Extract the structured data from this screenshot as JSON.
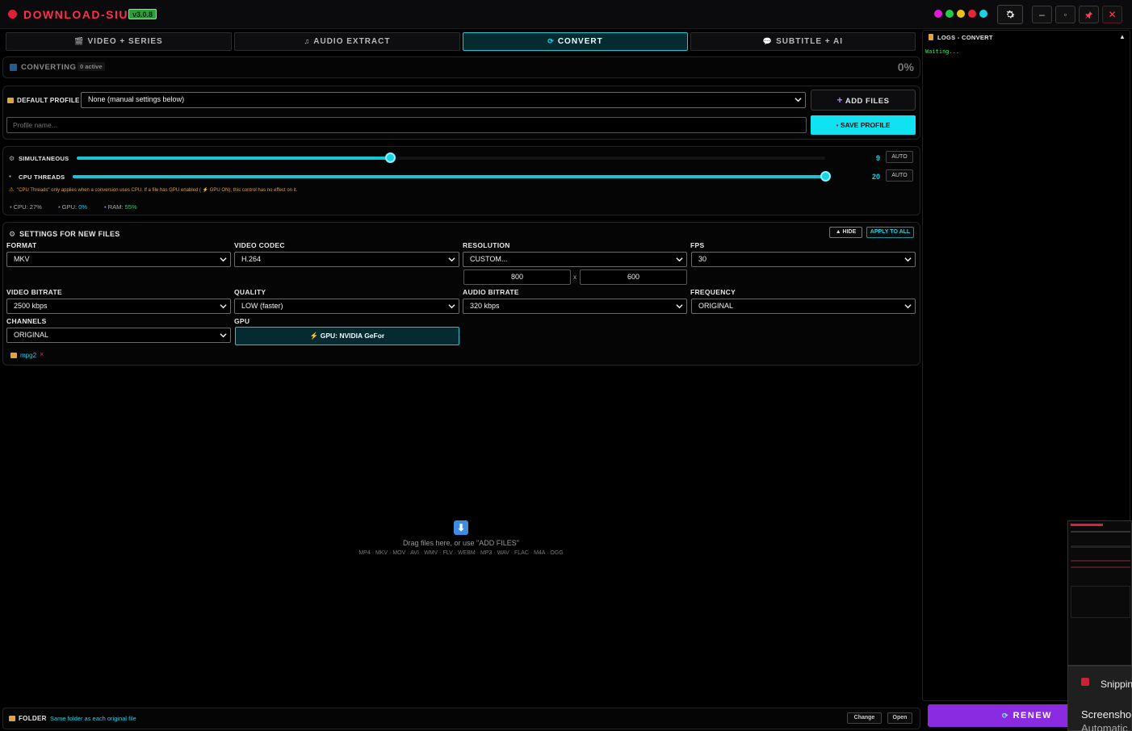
{
  "app": {
    "title": "DOWNLOAD-SIU",
    "version": "v3.0.8"
  },
  "theme_dots": [
    "#e01ad8",
    "#22cc44",
    "#e8c21a",
    "#e8263a",
    "#16d6e6"
  ],
  "window_controls": {
    "minimize": "–",
    "maximize": "▫",
    "close": "✕"
  },
  "tabs": [
    {
      "label": "VIDEO + SERIES",
      "icon": "🎬"
    },
    {
      "label": "AUDIO EXTRACT",
      "icon": "♫"
    },
    {
      "label": "CONVERT",
      "icon": "⟳"
    },
    {
      "label": "SUBTITLE + AI",
      "icon": "💬"
    }
  ],
  "status": {
    "label": "CONVERTING",
    "badge": "0 active",
    "percent": "0%",
    "progress": 0
  },
  "profile": {
    "label": "DEFAULT PROFILE",
    "selected": "None (manual settings below)",
    "name_placeholder": "Profile name...",
    "add_files": "ADD FILES",
    "save_profile": "SAVE PROFILE"
  },
  "sliders": {
    "simultaneous": {
      "label": "SIMULTANEOUS",
      "value": "9",
      "auto": "AUTO",
      "fraction": 0.42
    },
    "cpu_threads": {
      "label": "CPU THREADS",
      "value": "20",
      "auto": "AUTO",
      "fraction": 1.0
    },
    "warning": "\"CPU Threads\" only applies when a conversion uses CPU. If a file has GPU enabled ( ⚡ GPU ON), this control has no effect on it."
  },
  "usage": {
    "cpu_label": "CPU:",
    "cpu": "27%",
    "gpu_label": "GPU:",
    "gpu": "0%",
    "ram_label": "RAM:",
    "ram": "55%"
  },
  "settings": {
    "title": "SETTINGS FOR NEW FILES",
    "hide": "▲ HIDE",
    "apply_all": "APPLY TO ALL",
    "format": {
      "label": "FORMAT",
      "value": "MKV"
    },
    "video_codec": {
      "label": "VIDEO CODEC",
      "value": "H.264"
    },
    "resolution": {
      "label": "RESOLUTION",
      "value": "CUSTOM...",
      "width": "800",
      "height": "600",
      "sep": "x"
    },
    "fps": {
      "label": "FPS",
      "value": "30"
    },
    "video_bitrate": {
      "label": "VIDEO BITRATE",
      "value": "2500 kbps"
    },
    "quality": {
      "label": "QUALITY",
      "value": "LOW (faster)"
    },
    "audio_bitrate": {
      "label": "AUDIO BITRATE",
      "value": "320 kbps"
    },
    "frequency": {
      "label": "FREQUENCY",
      "value": "ORIGINAL"
    },
    "channels": {
      "label": "CHANNELS",
      "value": "ORIGINAL"
    },
    "gpu": {
      "label": "GPU",
      "value": "GPU: NVIDIA GeFor"
    },
    "tag": "mpg2"
  },
  "dropzone": {
    "title": "Drag files here, or use \"ADD FILES\"",
    "formats": "MP4 · MKV · MOV · AVI · WMV · FLV · WEBM · MP3 · WAV · FLAC · M4A · OGG"
  },
  "folder": {
    "label": "FOLDER",
    "value": "Same folder as each original file",
    "change": "Change",
    "open": "Open"
  },
  "logs": {
    "title": "LOGS - CONVERT",
    "line": "Waiting..."
  },
  "renew": "RENEW",
  "overlay": {
    "snip": "Snippin",
    "screenshot": "Screensho",
    "auto": "Automatic"
  }
}
